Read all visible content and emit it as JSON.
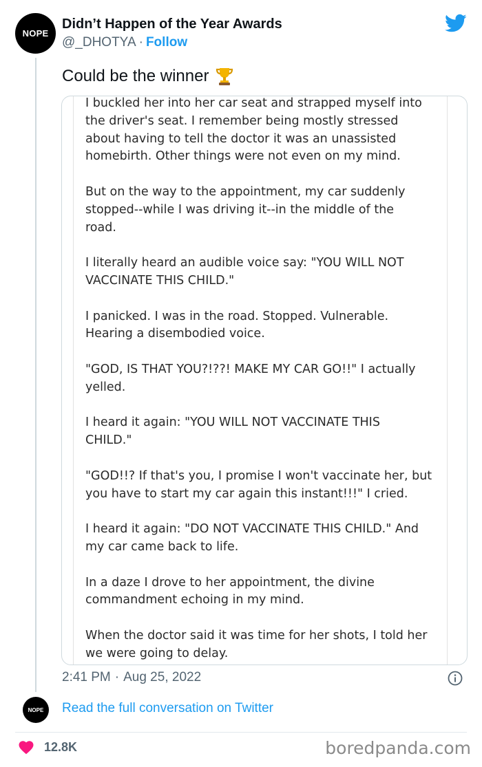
{
  "tweet": {
    "avatar_text": "NOPE",
    "display_name": "Didn’t Happen of the Year Awards",
    "handle": "@_DHOTYA",
    "separator": "·",
    "follow_label": "Follow",
    "text": "Could be the winner",
    "trophy_icon": "trophy-emoji",
    "image_paragraphs": [
      "I buckled her into her car seat and strapped myself into\nthe driver's seat. I remember being mostly stressed\nabout having to tell the doctor it was an unassisted\nhomebirth. Other things were not even on my mind.",
      "But on the way to the appointment, my car suddenly\nstopped--while I was driving it--in the middle of the\nroad.",
      "I literally heard an audible voice say: \"YOU WILL NOT\nVACCINATE THIS CHILD.\"",
      "I panicked. I was in the road. Stopped. Vulnerable.\nHearing a disembodied voice.",
      "\"GOD, IS THAT YOU?!??! MAKE MY CAR GO!!\" I actually\nyelled.",
      "I heard it again: \"YOU WILL NOT VACCINATE THIS\nCHILD.\"",
      "\"GOD!!? If that's you, I promise I won't vaccinate her, but\nyou have to start my car again this instant!!!\" I cried.",
      "I heard it again: \"DO NOT VACCINATE THIS CHILD.\" And\nmy car came back to life.",
      "In a daze I drove to her appointment, the divine\ncommandment echoing in my mind.",
      "When the doctor said it was time for her shots, I told her\nwe were going to delay."
    ],
    "time": "2:41 PM",
    "date": "Aug 25, 2022",
    "read_conversation_label": "Read the full conversation on Twitter",
    "like_count": "12.8K"
  },
  "watermark": "boredpanda.com",
  "colors": {
    "accent_blue": "#1d9bf0",
    "heart_red": "#f91880",
    "secondary_text": "#536471"
  }
}
